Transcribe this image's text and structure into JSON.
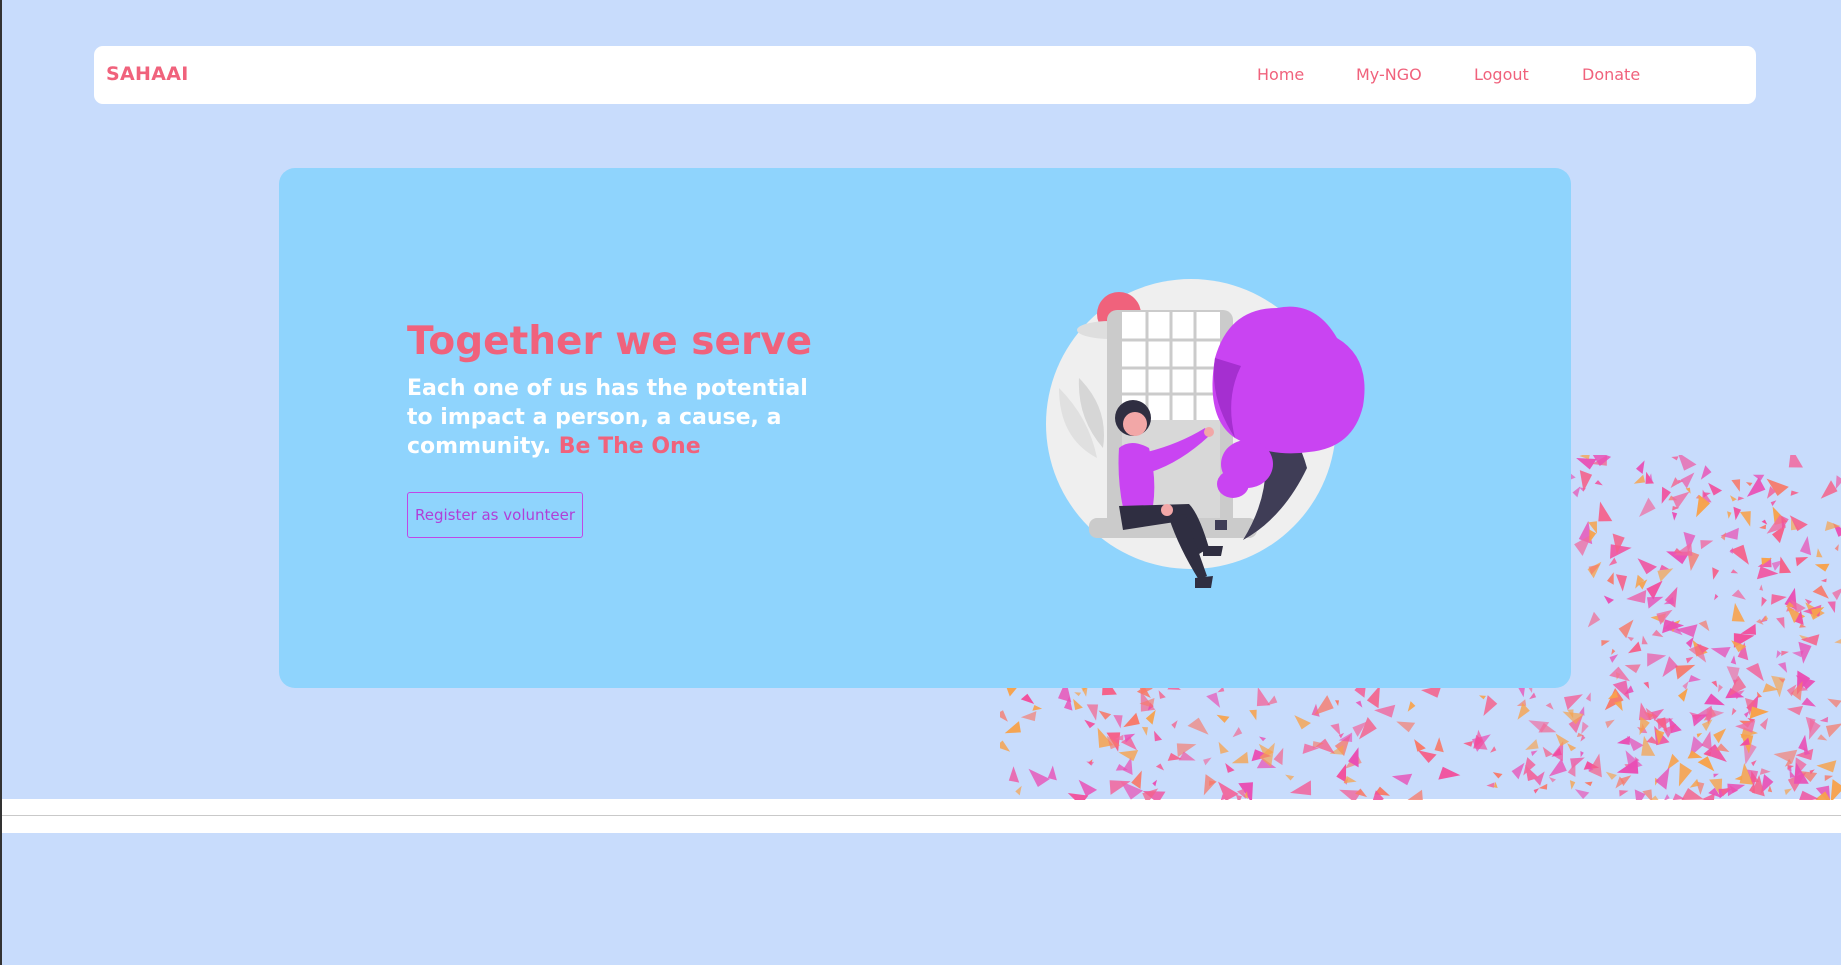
{
  "brand": "SAHAAI",
  "nav": {
    "home": "Home",
    "my_ngo": "My-NGO",
    "logout": "Logout",
    "donate": "Donate"
  },
  "hero": {
    "title": "Together we serve",
    "text": "Each one of us has the potential to impact a person, a cause, a community.",
    "highlight": "Be The One",
    "button": "Register as volunteer"
  },
  "colors": {
    "page_bg": "#c8dcfc",
    "hero_bg": "#8fd4fd",
    "accent_pink": "#f0627c",
    "accent_purple": "#c047e6"
  }
}
